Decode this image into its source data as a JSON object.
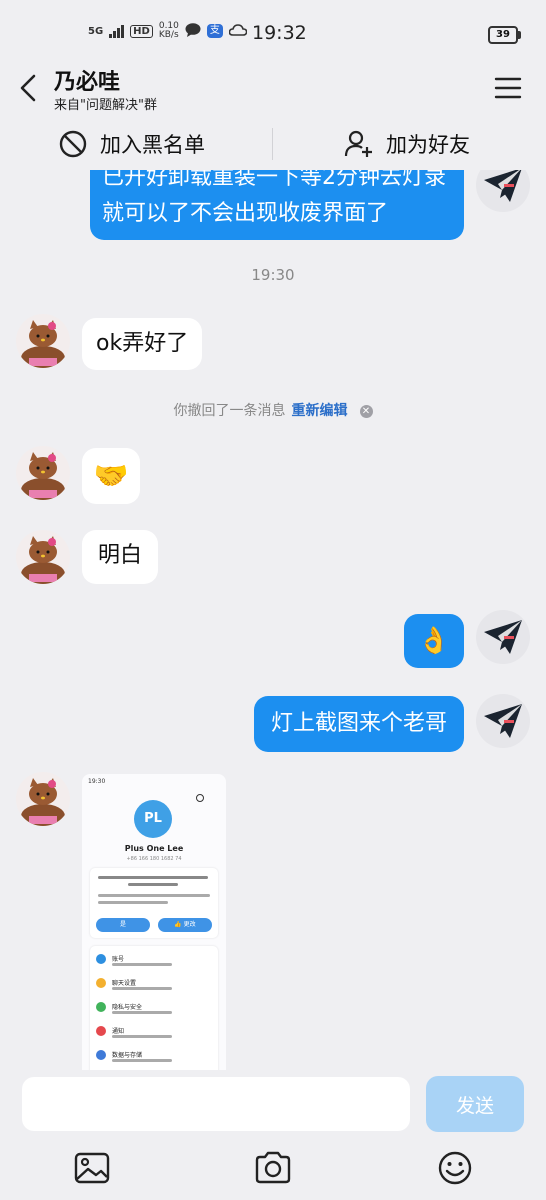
{
  "status": {
    "network": "5G",
    "hd": "HD",
    "speed": "0.10",
    "speed_unit": "KB/s",
    "alipay": "支",
    "time": "19:32",
    "battery": "39"
  },
  "header": {
    "name": "乃必哇",
    "subtitle": "来自\"问题解决\"群"
  },
  "actions": {
    "block": "加入黑名单",
    "add_friend": "加为好友"
  },
  "messages": {
    "out_long": "已开好卸载重装一下等2分钟去灯录就可以了不会出现收废界面了",
    "time_divider": "19:30",
    "in_ok": "ok弄好了",
    "recall_text": "你撤回了一条消息",
    "recall_edit": "重新编辑",
    "in_handshake": "🤝",
    "in_understood": "明白",
    "out_ok_emoji": "👌",
    "out_screenshot_request": "灯上截图来个老哥"
  },
  "screenshot_thumb": {
    "time": "19:30",
    "initials": "PL",
    "name": "Plus One Lee",
    "number": "+86 166 180 1682 74",
    "btn_yes": "是",
    "btn_no": "👍 更改",
    "rows": [
      "账号",
      "聊天设置",
      "隐私与安全",
      "通知",
      "数据与存储"
    ],
    "row_colors": [
      "#2d8fe0",
      "#f3b02f",
      "#41b35b",
      "#e5484d",
      "#3f7ad8"
    ]
  },
  "input": {
    "placeholder": "",
    "send": "发送"
  },
  "colors": {
    "accent": "#1c8ff0",
    "background": "#efeff2",
    "send_disabled": "#a9d3f6"
  }
}
